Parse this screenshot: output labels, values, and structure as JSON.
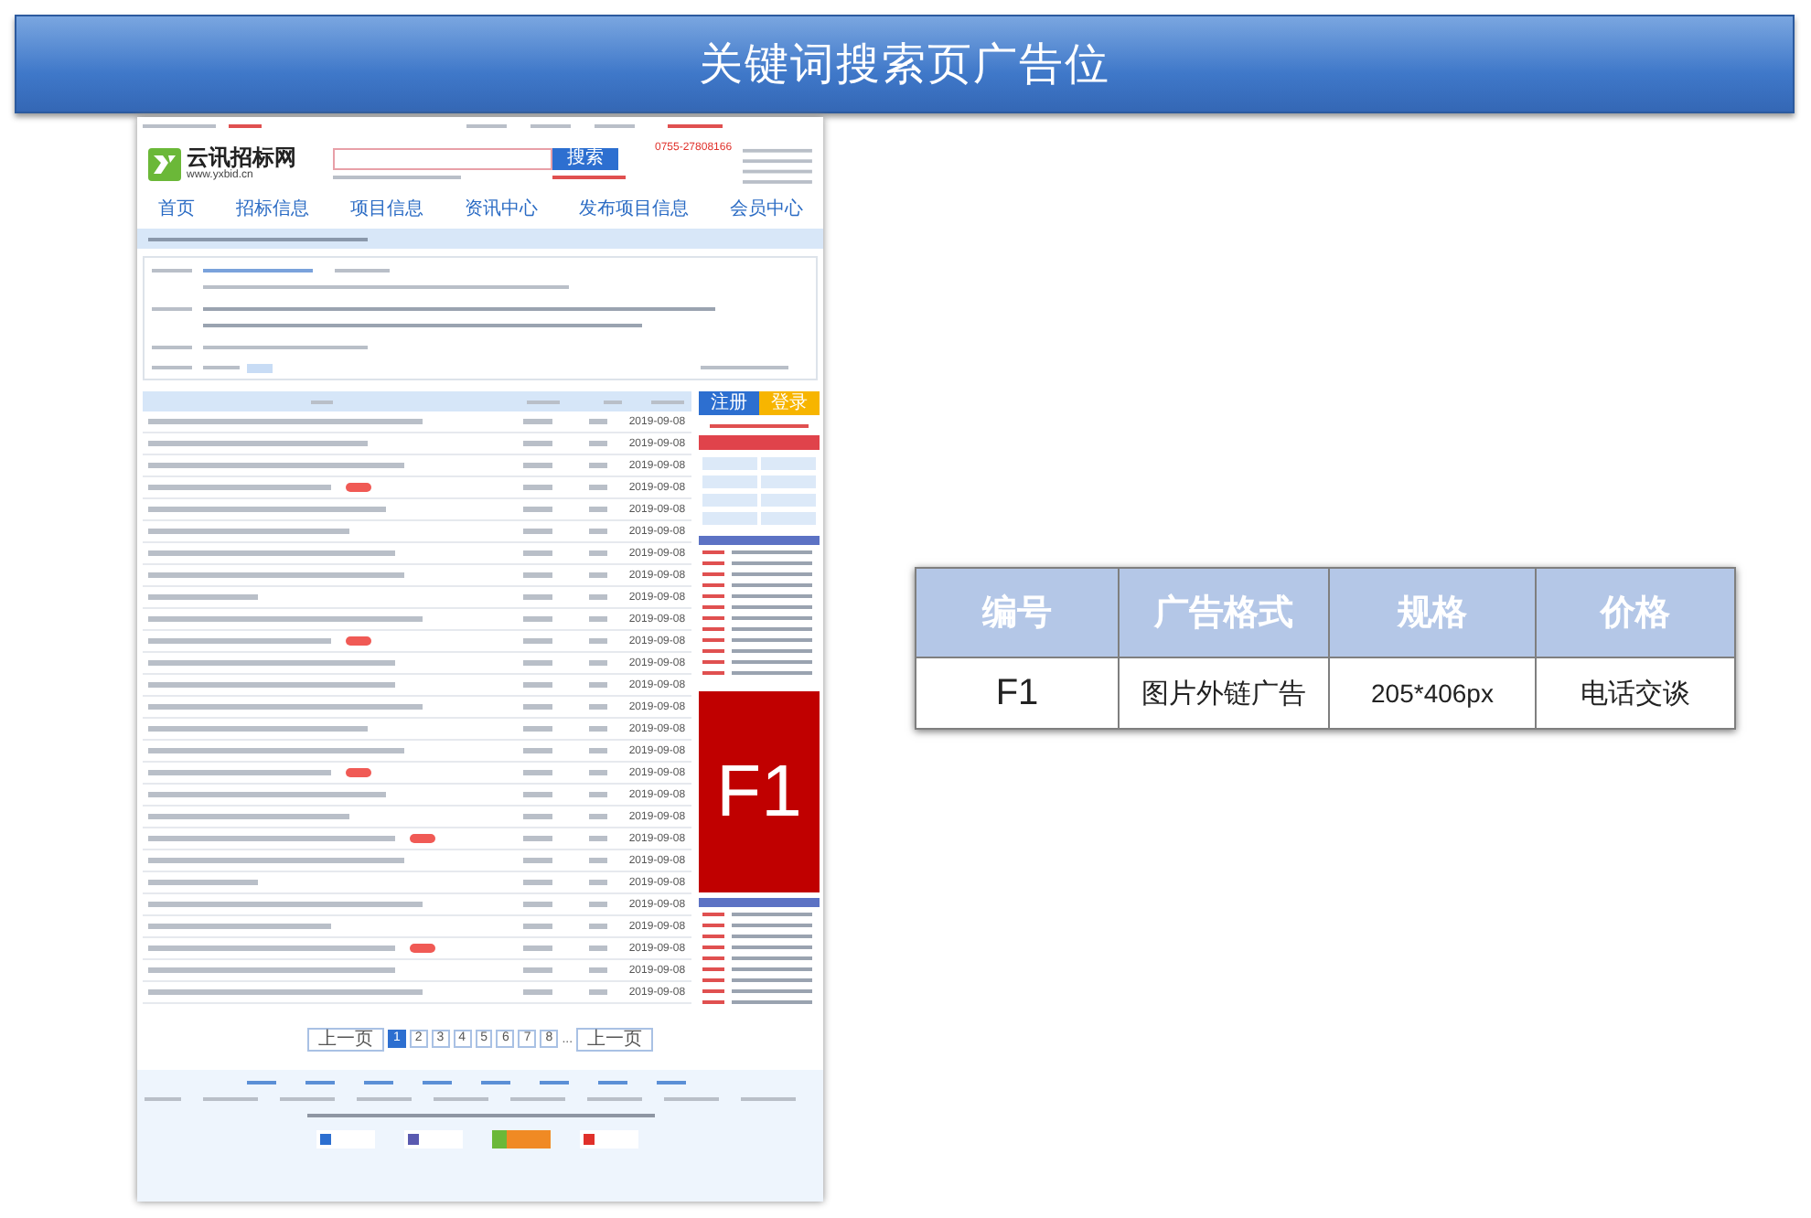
{
  "header": {
    "title": "关键词搜索页广告位"
  },
  "mockup": {
    "site_name": "云讯招标网",
    "site_url": "www.yxbid.cn",
    "hotline": "0755-27808166",
    "search_button": "搜索",
    "nav": [
      "首页",
      "招标信息",
      "项目信息",
      "资讯中心",
      "发布项目信息",
      "会员中心"
    ],
    "table": {
      "rows": [
        {
          "date": "2019-09-08",
          "badge": false
        },
        {
          "date": "2019-09-08",
          "badge": false
        },
        {
          "date": "2019-09-08",
          "badge": false
        },
        {
          "date": "2019-09-08",
          "badge": true
        },
        {
          "date": "2019-09-08",
          "badge": false
        },
        {
          "date": "2019-09-08",
          "badge": false
        },
        {
          "date": "2019-09-08",
          "badge": false
        },
        {
          "date": "2019-09-08",
          "badge": false
        },
        {
          "date": "2019-09-08",
          "badge": false
        },
        {
          "date": "2019-09-08",
          "badge": false
        },
        {
          "date": "2019-09-08",
          "badge": true
        },
        {
          "date": "2019-09-08",
          "badge": false
        },
        {
          "date": "2019-09-08",
          "badge": false
        },
        {
          "date": "2019-09-08",
          "badge": false
        },
        {
          "date": "2019-09-08",
          "badge": false
        },
        {
          "date": "2019-09-08",
          "badge": false
        },
        {
          "date": "2019-09-08",
          "badge": true
        },
        {
          "date": "2019-09-08",
          "badge": false
        },
        {
          "date": "2019-09-08",
          "badge": false
        },
        {
          "date": "2019-09-08",
          "badge": true
        },
        {
          "date": "2019-09-08",
          "badge": false
        },
        {
          "date": "2019-09-08",
          "badge": false
        },
        {
          "date": "2019-09-08",
          "badge": false
        },
        {
          "date": "2019-09-08",
          "badge": false
        },
        {
          "date": "2019-09-08",
          "badge": true
        },
        {
          "date": "2019-09-08",
          "badge": false
        },
        {
          "date": "2019-09-08",
          "badge": false
        }
      ]
    },
    "register_button": "注册",
    "login_button": "登录",
    "ad": {
      "label": "F1"
    },
    "pagination": {
      "prev": "上一页",
      "pages": [
        {
          "label": "1",
          "selected": true
        },
        {
          "label": "2",
          "selected": false
        },
        {
          "label": "3",
          "selected": false
        },
        {
          "label": "4",
          "selected": false
        },
        {
          "label": "5",
          "selected": false
        },
        {
          "label": "6",
          "selected": false
        },
        {
          "label": "7",
          "selected": false
        },
        {
          "label": "8",
          "selected": false
        }
      ],
      "ellipsis": "...",
      "next": "上一页"
    }
  },
  "spec_table": {
    "columns": [
      "编号",
      "广告格式",
      "规格",
      "价格"
    ],
    "rows": [
      [
        "F1",
        "图片外链广告",
        "205*406px",
        "电话交谈"
      ]
    ]
  }
}
